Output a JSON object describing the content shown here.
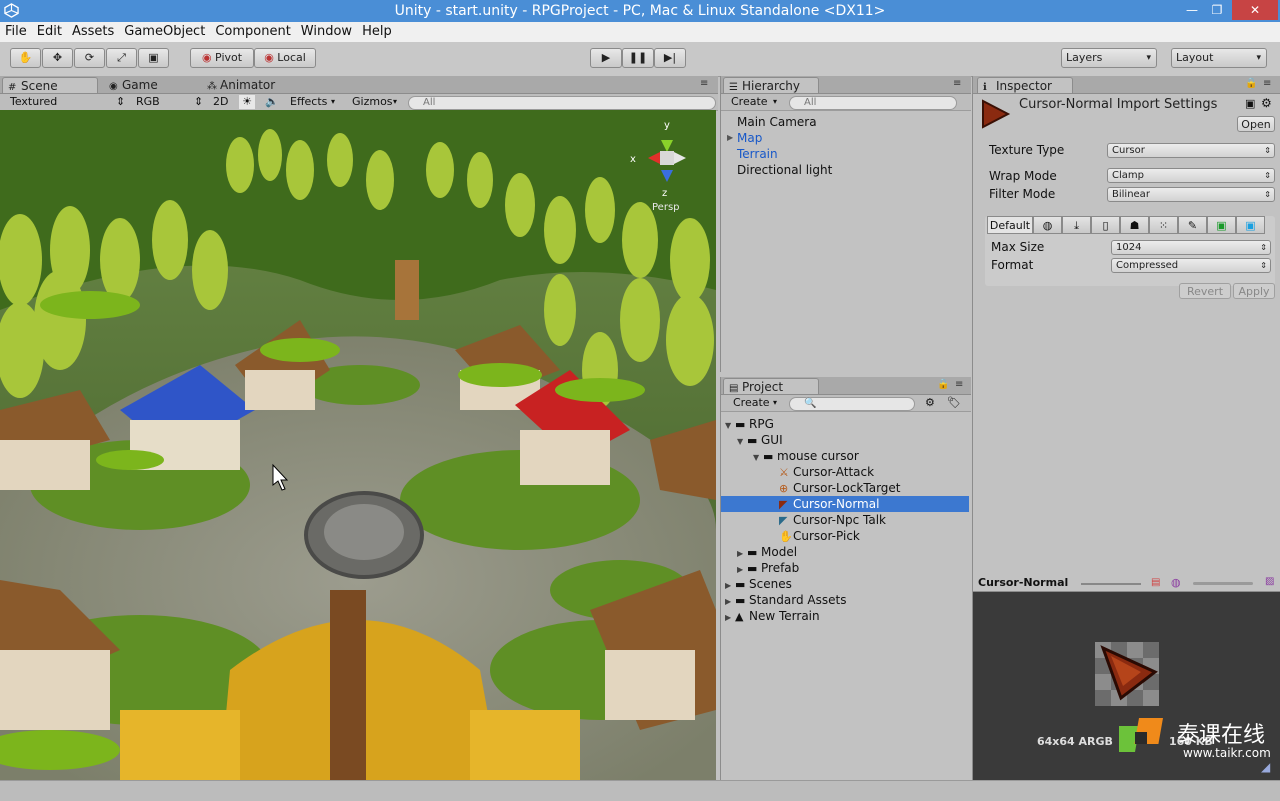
{
  "window": {
    "title": "Unity - start.unity - RPGProject - PC, Mac & Linux Standalone <DX11>",
    "minimize": "—",
    "restore": "❐",
    "close": "✕"
  },
  "menu": [
    "File",
    "Edit",
    "Assets",
    "GameObject",
    "Component",
    "Window",
    "Help"
  ],
  "toolbar": {
    "tools": [
      "hand-tool-icon",
      "move-tool-icon",
      "rotate-tool-icon",
      "scale-tool-icon",
      "rect-tool-icon"
    ],
    "tool_glyphs": [
      "✋",
      "✥",
      "⟳",
      "⤢",
      "▣"
    ],
    "pivot": "Pivot",
    "local": "Local",
    "play": "▶",
    "pause": "❚❚",
    "step": "▶|",
    "layers": "Layers",
    "layout": "Layout"
  },
  "scene": {
    "tabs": [
      {
        "label": "Scene",
        "icon": "#"
      },
      {
        "label": "Game",
        "icon": "◉"
      },
      {
        "label": "Animator",
        "icon": "⁂"
      }
    ],
    "shading": "Textured",
    "render_mode": "RGB",
    "mode_2d": "2D",
    "effects": "Effects",
    "gizmos": "Gizmos",
    "search": "All",
    "gizmo_axes": {
      "y": "y",
      "x": "x",
      "z": "z"
    },
    "persp": "Persp"
  },
  "hierarchy": {
    "tab": "Hierarchy",
    "create": "Create",
    "search": "All",
    "items": [
      {
        "label": "Main Camera",
        "expandable": false,
        "highlight": false
      },
      {
        "label": "Map",
        "expandable": true,
        "highlight": true
      },
      {
        "label": "Terrain",
        "expandable": false,
        "highlight": true
      },
      {
        "label": "Directional light",
        "expandable": false,
        "highlight": false
      }
    ]
  },
  "project": {
    "tab": "Project",
    "create": "Create",
    "tree": [
      {
        "label": "RPG",
        "depth": 0,
        "kind": "folder",
        "open": true
      },
      {
        "label": "GUI",
        "depth": 1,
        "kind": "folder",
        "open": true
      },
      {
        "label": "mouse cursor",
        "depth": 2,
        "kind": "folder",
        "open": true
      },
      {
        "label": "Cursor-Attack",
        "depth": 3,
        "kind": "cursor-attack"
      },
      {
        "label": "Cursor-LockTarget",
        "depth": 3,
        "kind": "cursor-lock"
      },
      {
        "label": "Cursor-Normal",
        "depth": 3,
        "kind": "cursor-normal",
        "selected": true
      },
      {
        "label": "Cursor-Npc Talk",
        "depth": 3,
        "kind": "cursor-talk"
      },
      {
        "label": "Cursor-Pick",
        "depth": 3,
        "kind": "cursor-pick"
      },
      {
        "label": "Model",
        "depth": 1,
        "kind": "folder",
        "open": false
      },
      {
        "label": "Prefab",
        "depth": 1,
        "kind": "folder",
        "open": false
      },
      {
        "label": "Scenes",
        "depth": 0,
        "kind": "folder",
        "open": false
      },
      {
        "label": "Standard Assets",
        "depth": 0,
        "kind": "folder",
        "open": false
      },
      {
        "label": "New Terrain",
        "depth": 0,
        "kind": "terrain",
        "open": false
      }
    ]
  },
  "inspector": {
    "tab": "Inspector",
    "header_title": "Cursor-Normal Import Settings",
    "open_button": "Open",
    "texture_type_label": "Texture Type",
    "texture_type_value": "Cursor",
    "wrap_mode_label": "Wrap Mode",
    "wrap_mode_value": "Clamp",
    "filter_mode_label": "Filter Mode",
    "filter_mode_value": "Bilinear",
    "platform_default": "Default",
    "platform_icons": [
      "globe-icon",
      "download-icon",
      "phone-icon",
      "android-icon",
      "blackberry-icon",
      "flash-icon",
      "xbox-icon",
      "windows-store-icon"
    ],
    "platform_glyphs": [
      "◍",
      "⤓",
      "▯",
      "☗",
      "⁙",
      "✎",
      "▣",
      "▣"
    ],
    "max_size_label": "Max Size",
    "max_size_value": "1024",
    "format_label": "Format",
    "format_value": "Compressed",
    "revert": "Revert",
    "apply": "Apply"
  },
  "preview": {
    "title": "Cursor-Normal",
    "info": "64x64  ARGB",
    "info_tail": "160 KB"
  },
  "watermark": {
    "brand": "泰课在线",
    "url": "www.taikr.com"
  },
  "colors": {
    "titlebar": "#4a8ed6",
    "selection": "#3c78d0",
    "hierarchy_link": "#1858c8"
  }
}
